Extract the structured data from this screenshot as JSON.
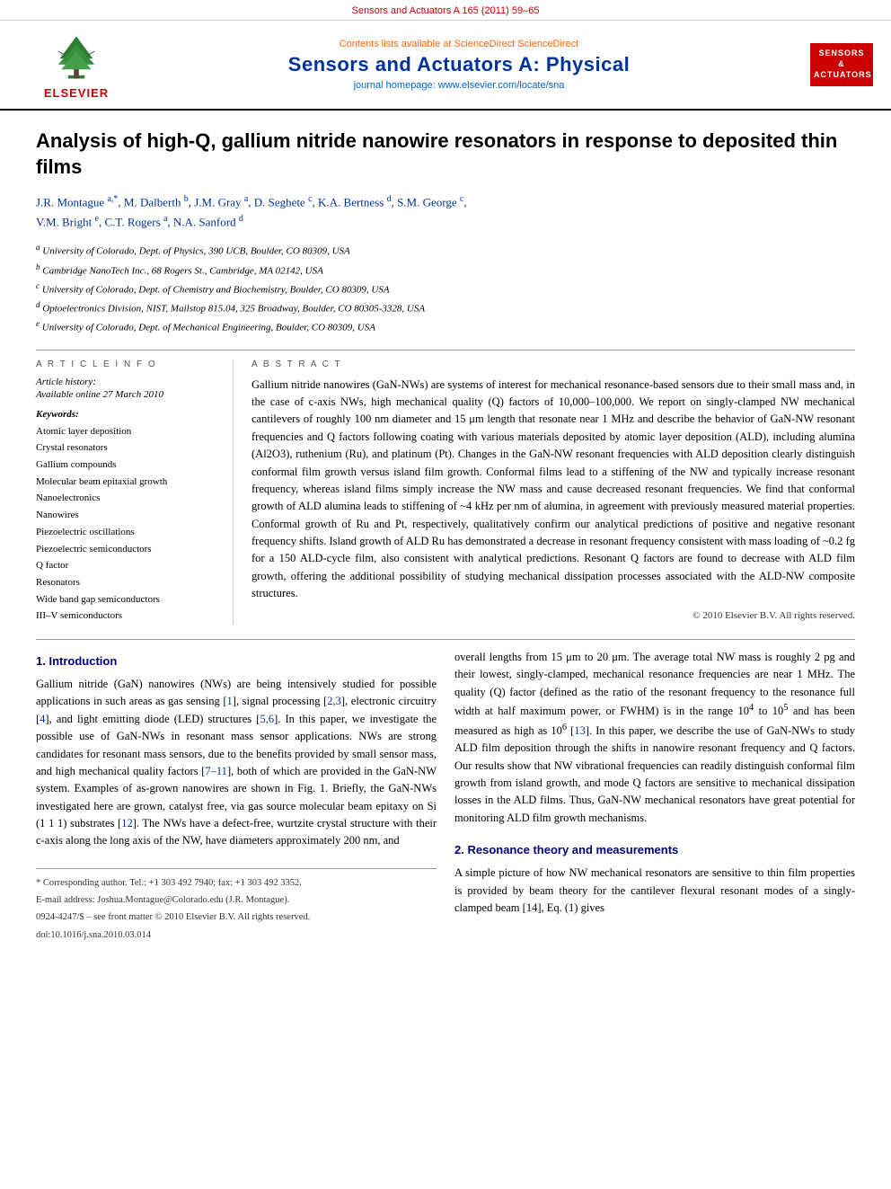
{
  "topbar": {
    "text": "Sensors and Actuators A 165 (2011) 59–65"
  },
  "banner": {
    "sciencedirect": "Contents lists available at ScienceDirect",
    "sciencedirect_brand": "ScienceDirect",
    "journal_title": "Sensors and Actuators A: Physical",
    "homepage_label": "journal homepage:",
    "homepage_url": "www.elsevier.com/locate/sna",
    "badge_text": "SENSORS\nAND\nACTUATORS"
  },
  "article": {
    "title": "Analysis of high-Q, gallium nitride nanowire resonators in response to deposited thin films",
    "authors": "J.R. Montague a,*, M. Dalberth b, J.M. Gray a, D. Seghete c, K.A. Bertness d, S.M. George c, V.M. Bright e, C.T. Rogers a, N.A. Sanford d",
    "affiliations": [
      "a University of Colorado, Dept. of Physics, 390 UCB, Boulder, CO 80309, USA",
      "b Cambridge NanoTech Inc., 68 Rogers St., Cambridge, MA 02142, USA",
      "c University of Colorado, Dept. of Chemistry and Biochemistry, Boulder, CO 80309, USA",
      "d Optoelectronics Division, NIST, Mailstop 815.04, 325 Broadway, Boulder, CO 80305-3328, USA",
      "e University of Colorado, Dept. of Mechanical Engineering, Boulder, CO 80309, USA"
    ]
  },
  "article_info": {
    "header": "A R T I C L E   I N F O",
    "history_label": "Article history:",
    "history_value": "Available online 27 March 2010",
    "keywords_label": "Keywords:",
    "keywords": [
      "Atomic layer deposition",
      "Crystal resonators",
      "Gallium compounds",
      "Molecular beam epitaxial growth",
      "Nanoelectronics",
      "Nanowires",
      "Piezoelectric oscillations",
      "Piezoelectric semiconductors",
      "Q factor",
      "Resonators",
      "Wide band gap semiconductors",
      "III–V semiconductors"
    ]
  },
  "abstract": {
    "header": "A B S T R A C T",
    "text": "Gallium nitride nanowires (GaN-NWs) are systems of interest for mechanical resonance-based sensors due to their small mass and, in the case of c-axis NWs, high mechanical quality (Q) factors of 10,000–100,000. We report on singly-clamped NW mechanical cantilevers of roughly 100 nm diameter and 15 μm length that resonate near 1 MHz and describe the behavior of GaN-NW resonant frequencies and Q factors following coating with various materials deposited by atomic layer deposition (ALD), including alumina (Al2O3), ruthenium (Ru), and platinum (Pt). Changes in the GaN-NW resonant frequencies with ALD deposition clearly distinguish conformal film growth versus island film growth. Conformal films lead to a stiffening of the NW and typically increase resonant frequency, whereas island films simply increase the NW mass and cause decreased resonant frequencies. We find that conformal growth of ALD alumina leads to stiffening of ~4 kHz per nm of alumina, in agreement with previously measured material properties. Conformal growth of Ru and Pt, respectively, qualitatively confirm our analytical predictions of positive and negative resonant frequency shifts. Island growth of ALD Ru has demonstrated a decrease in resonant frequency consistent with mass loading of ~0.2 fg for a 150 ALD-cycle film, also consistent with analytical predictions. Resonant Q factors are found to decrease with ALD film growth, offering the additional possibility of studying mechanical dissipation processes associated with the ALD-NW composite structures.",
    "copyright": "© 2010 Elsevier B.V. All rights reserved."
  },
  "intro": {
    "section_num": "1.",
    "section_title": "Introduction",
    "text": "Gallium nitride (GaN) nanowires (NWs) are being intensively studied for possible applications in such areas as gas sensing [1], signal processing [2,3], electronic circuitry [4], and light emitting diode (LED) structures [5,6]. In this paper, we investigate the possible use of GaN-NWs in resonant mass sensor applications. NWs are strong candidates for resonant mass sensors, due to the benefits provided by small sensor mass, and high mechanical quality factors [7–11], both of which are provided in the GaN-NW system. Examples of as-grown nanowires are shown in Fig. 1. Briefly, the GaN-NWs investigated here are grown, catalyst free, via gas source molecular beam epitaxy on Si (1 1 1) substrates [12]. The NWs have a defect-free, wurtzite crystal structure with their c-axis along the long axis of the NW, have diameters approximately 200 nm, and"
  },
  "resonance": {
    "section_num": "2.",
    "section_title": "Resonance theory and measurements",
    "text": "A simple picture of how NW mechanical resonators are sensitive to thin film properties is provided by beam theory for the cantilever flexural resonant modes of a singly-clamped beam [14], Eq. (1) gives"
  },
  "right_col": {
    "text": "overall lengths from 15 μm to 20 μm. The average total NW mass is roughly 2 pg and their lowest, singly-clamped, mechanical resonance frequencies are near 1 MHz. The quality (Q) factor (defined as the ratio of the resonant frequency to the resonance full width at half maximum power, or FWHM) is in the range 10⁴ to 10⁵ and has been measured as high as 10⁶ [13]. In this paper, we describe the use of GaN-NWs to study ALD film deposition through the shifts in nanowire resonant frequency and Q factors. Our results show that NW vibrational frequencies can readily distinguish conformal film growth from island growth, and mode Q factors are sensitive to mechanical dissipation losses in the ALD films. Thus, GaN-NW mechanical resonators have great potential for monitoring ALD film growth mechanisms."
  },
  "footer": {
    "note1": "* Corresponding author. Tel.: +1 303 492 7940; fax: +1 303 492 3352.",
    "note2": "E-mail address: Joshua.Montague@Colorado.edu (J.R. Montague).",
    "note3": "0924-4247/$ – see front matter © 2010 Elsevier B.V. All rights reserved.",
    "note4": "doi:10.1016/j.sna.2010.03.014"
  }
}
